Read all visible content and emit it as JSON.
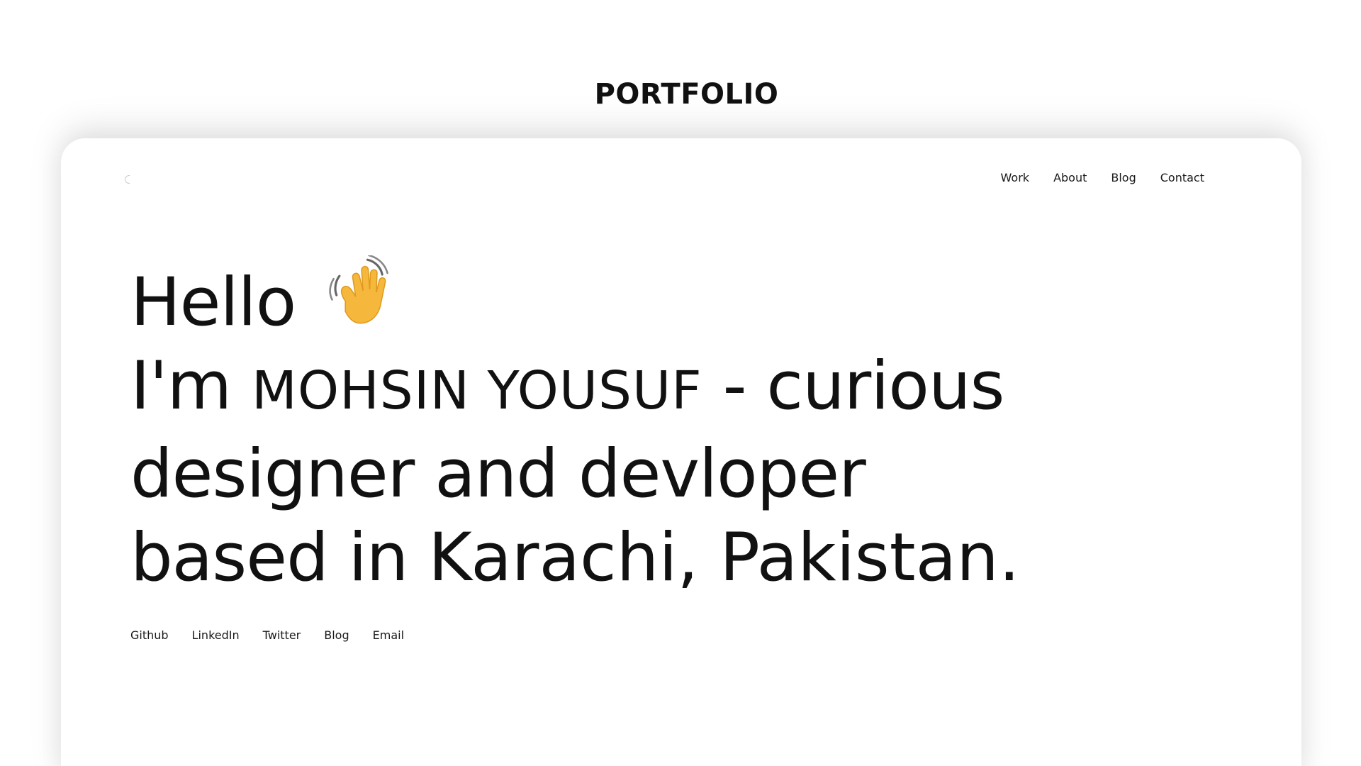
{
  "header": {
    "title": "PORTFOLIO"
  },
  "nav": {
    "items": [
      {
        "label": "Work"
      },
      {
        "label": "About"
      },
      {
        "label": "Blog"
      },
      {
        "label": "Contact"
      }
    ]
  },
  "hero": {
    "greeting": "Hello",
    "greeting_icon": "waving-hand-icon",
    "intro_prefix": "I'm",
    "name": "MOHSIN YOUSUF",
    "intro_suffix": "- curious",
    "line3": "designer and devloper",
    "line4_prefix": "based in",
    "location": "Karachi, Pakistan."
  },
  "socials": {
    "items": [
      {
        "label": "Github"
      },
      {
        "label": "LinkedIn"
      },
      {
        "label": "Twitter"
      },
      {
        "label": "Blog"
      },
      {
        "label": "Email"
      }
    ]
  },
  "colors": {
    "text": "#111111",
    "background": "#ffffff",
    "wave": "#F5B83D"
  }
}
